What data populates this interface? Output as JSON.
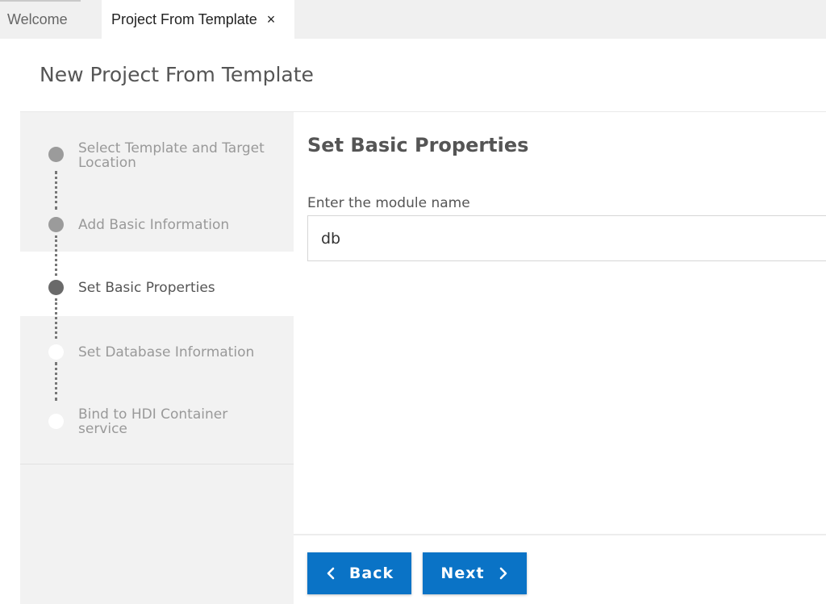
{
  "tabs": [
    {
      "label": "Welcome"
    },
    {
      "label": "Project From Template",
      "close": "×"
    }
  ],
  "page": {
    "title": "New Project From Template"
  },
  "steps": [
    {
      "line1": "Select Template and Target",
      "line2": "Location",
      "state": "done"
    },
    {
      "line1": "Add Basic Information",
      "state": "done"
    },
    {
      "line1": "Set Basic Properties",
      "state": "current"
    },
    {
      "line1": "Set Database Information",
      "state": "todo"
    },
    {
      "line1": "Bind to HDI Container",
      "line2": "service",
      "state": "todo"
    }
  ],
  "content": {
    "title": "Set Basic Properties",
    "module_label": "Enter the module name",
    "module_value": "db"
  },
  "buttons": {
    "back": "Back",
    "next": "Next"
  },
  "icons": {
    "back": "chevron-left-icon",
    "next": "chevron-right-icon",
    "close": "close-icon"
  },
  "colors": {
    "primary": "#0a73c6",
    "sidebar": "#f2f2f2"
  }
}
